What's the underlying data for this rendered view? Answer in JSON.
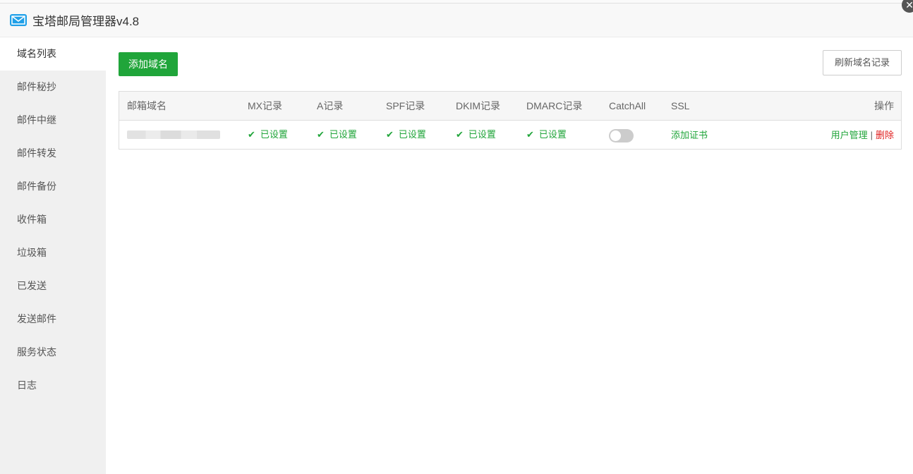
{
  "window": {
    "title": "宝塔邮局管理器v4.8",
    "close_glyph": "✕",
    "logo_icon": "mail-icon",
    "accent": "#20a53a"
  },
  "sidebar": {
    "items": [
      {
        "label": "域名列表",
        "active": true
      },
      {
        "label": "邮件秘抄"
      },
      {
        "label": "邮件中继"
      },
      {
        "label": "邮件转发"
      },
      {
        "label": "邮件备份"
      },
      {
        "label": "收件箱"
      },
      {
        "label": "垃圾箱"
      },
      {
        "label": "已发送"
      },
      {
        "label": "发送邮件"
      },
      {
        "label": "服务状态"
      },
      {
        "label": "日志"
      }
    ]
  },
  "toolbar": {
    "add_domain_label": "添加域名",
    "refresh_label": "刷新域名记录"
  },
  "table": {
    "headers": {
      "domain": "邮箱域名",
      "mx": "MX记录",
      "a": "A记录",
      "spf": "SPF记录",
      "dkim": "DKIM记录",
      "dmarc": "DMARC记录",
      "catchall": "CatchAll",
      "ssl": "SSL",
      "op": "操作"
    },
    "rows": [
      {
        "mx": "已设置",
        "a": "已设置",
        "spf": "已设置",
        "dkim": "已设置",
        "dmarc": "已设置",
        "catchall_enabled": false,
        "ssl": "添加证书",
        "op_users": "用户管理",
        "op_sep": "|",
        "op_delete": "删除"
      }
    ],
    "check_glyph": "✔"
  }
}
